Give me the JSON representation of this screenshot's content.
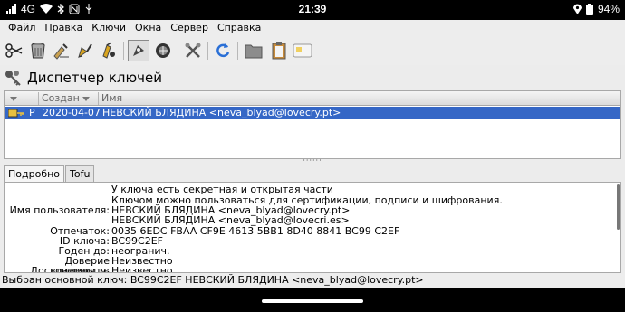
{
  "system_status": {
    "network": "4G",
    "clock": "21:39",
    "battery": "94%"
  },
  "menu": [
    "Файл",
    "Правка",
    "Ключи",
    "Окна",
    "Сервер",
    "Справка"
  ],
  "header": {
    "title": "Диспетчер ключей"
  },
  "table": {
    "columns": [
      "",
      "Создан",
      "Имя"
    ],
    "row": {
      "type": "P",
      "created": "2020-04-07",
      "name": "НЕВСКИЙ БЛЯДИНА <neva_blyad@lovecry.pt>"
    }
  },
  "tabs": [
    "Подробно",
    "Tofu"
  ],
  "details": {
    "line1": "У ключа есть секретная и открытая части",
    "line2": "Ключом можно пользоваться для сертификации, подписи и шифрования.",
    "user_label": "Имя пользователя:",
    "user_1": "НЕВСКИЙ БЛЯДИНА <neva_blyad@lovecry.pt>",
    "user_2": "НЕВСКИЙ БЛЯДИНА <neva_blyad@lovecri.es>",
    "fp_label": "Отпечаток:",
    "fp_value": "0035 6EDC FBAA CF9E 4613  5BB1 8D40 8841 BC99 C2EF",
    "id_label": "ID ключа:",
    "id_value": "BC99C2EF",
    "valid_label": "Годен до:",
    "valid_value": "неогранич.",
    "owner_label": "Доверие владельцу:",
    "owner_value": "Неизвестно",
    "trust_label": "Достоверность ключа:",
    "trust_value": "Неизвестно"
  },
  "status": "Выбран основной ключ: BC99C2EF НЕВСКИЙ БЛЯДИНА <neva_blyad@lovecry.pt>"
}
